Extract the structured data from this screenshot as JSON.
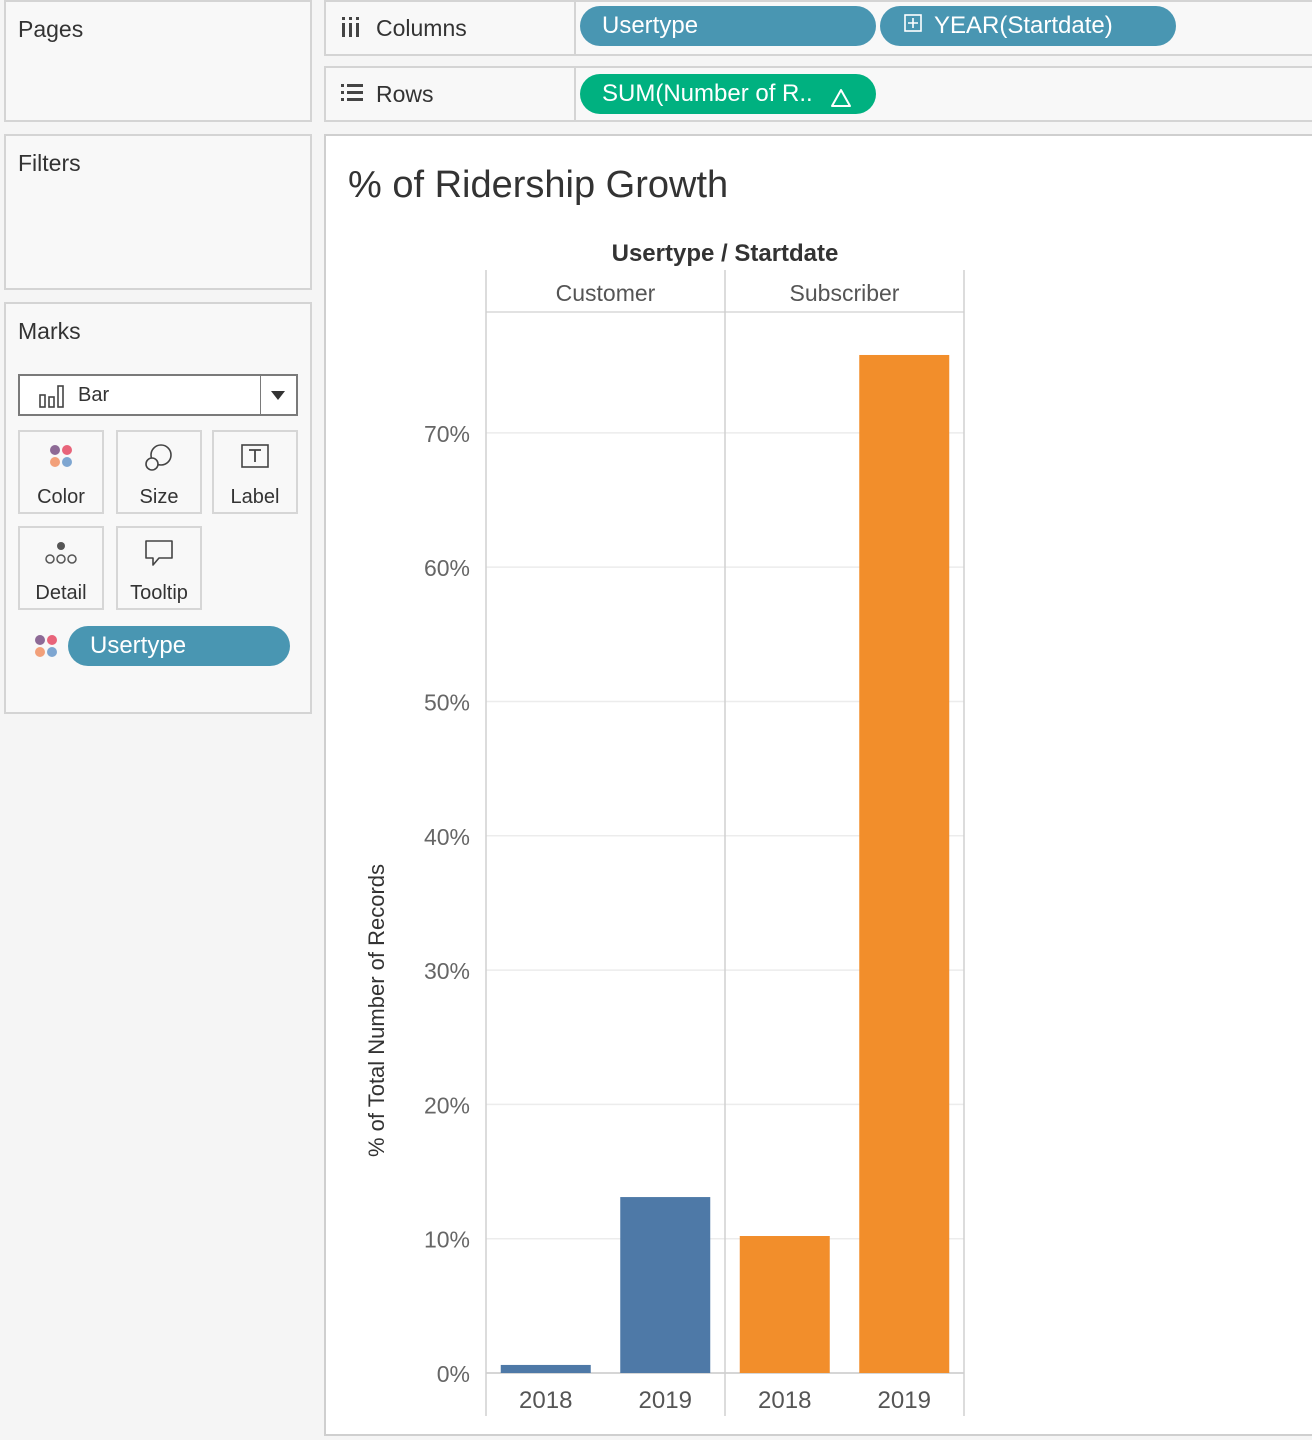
{
  "cards": {
    "pages_title": "Pages",
    "filters_title": "Filters",
    "marks_title": "Marks"
  },
  "marks": {
    "type_label": "Bar",
    "buttons": {
      "color": "Color",
      "size": "Size",
      "label": "Label",
      "detail": "Detail",
      "tooltip": "Tooltip"
    },
    "color_pill": "Usertype"
  },
  "shelves": {
    "columns_label": "Columns",
    "columns_pills": [
      "Usertype",
      "YEAR(Startdate)"
    ],
    "rows_label": "Rows",
    "rows_pill": "SUM(Number of R..",
    "rows_pill_icon": "delta-icon"
  },
  "viz": {
    "title": "% of Ridership Growth"
  },
  "colors": {
    "pill_blue": "#4996b2",
    "pill_green": "#00b180",
    "customer": "#4e79a7",
    "subscriber": "#f28e2b"
  },
  "chart_data": {
    "type": "bar",
    "title": "% of Ridership Growth",
    "header_title": "Usertype / Startdate",
    "ylabel": "% of Total Number of Records",
    "xlabel": "",
    "ylim": [
      0,
      79
    ],
    "yticks": [
      0,
      10,
      20,
      30,
      40,
      50,
      60,
      70
    ],
    "ytick_labels": [
      "0%",
      "10%",
      "20%",
      "30%",
      "40%",
      "50%",
      "60%",
      "70%"
    ],
    "grid": true,
    "panes": [
      {
        "name": "Customer",
        "color": "#4e79a7",
        "categories": [
          "2018",
          "2019"
        ],
        "values": [
          0.6,
          13.1
        ]
      },
      {
        "name": "Subscriber",
        "color": "#f28e2b",
        "categories": [
          "2018",
          "2019"
        ],
        "values": [
          10.2,
          75.8
        ]
      }
    ]
  }
}
